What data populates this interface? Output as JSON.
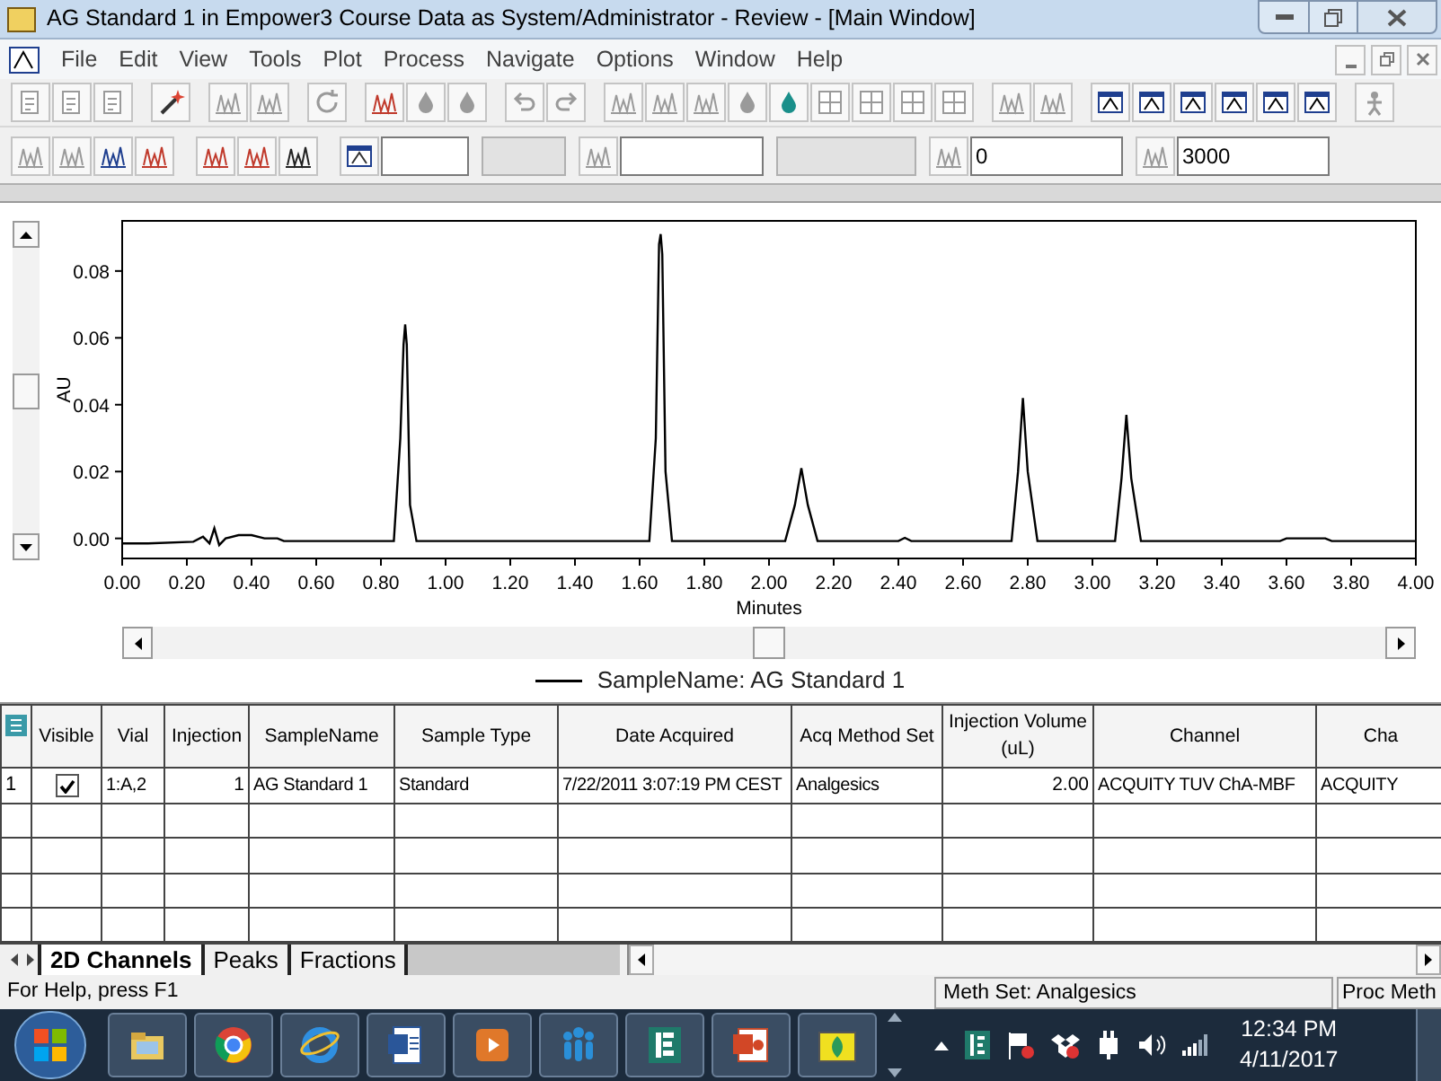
{
  "window": {
    "title": "AG Standard 1 in Empower3 Course Data as System/Administrator - Review - [Main Window]"
  },
  "menu": [
    "File",
    "Edit",
    "View",
    "Tools",
    "Plot",
    "Process",
    "Navigate",
    "Options",
    "Window",
    "Help"
  ],
  "toolbar_fields": [
    {
      "disabled": false
    },
    {
      "disabled": true
    },
    {
      "disabled": false
    },
    {
      "disabled": true
    },
    {
      "value": "0",
      "disabled": false
    },
    {
      "value": "3000",
      "disabled": false
    }
  ],
  "chromatogram": {
    "chart_data": {
      "type": "line",
      "xlabel": "Minutes",
      "ylabel": "AU",
      "xlim": [
        0,
        4
      ],
      "ylim": [
        -0.006,
        0.095
      ],
      "xticks": [
        {
          "value": 0,
          "label": "0.00"
        },
        {
          "value": 0.2,
          "label": "0.20"
        },
        {
          "value": 0.4,
          "label": "0.40"
        },
        {
          "value": 0.6,
          "label": "0.60"
        },
        {
          "value": 0.8,
          "label": "0.80"
        },
        {
          "value": 1,
          "label": "1.00"
        },
        {
          "value": 1.2,
          "label": "1.20"
        },
        {
          "value": 1.4,
          "label": "1.40"
        },
        {
          "value": 1.6,
          "label": "1.60"
        },
        {
          "value": 1.8,
          "label": "1.80"
        },
        {
          "value": 2,
          "label": "2.00"
        },
        {
          "value": 2.2,
          "label": "2.20"
        },
        {
          "value": 2.4,
          "label": "2.40"
        },
        {
          "value": 2.6,
          "label": "2.60"
        },
        {
          "value": 2.8,
          "label": "2.80"
        },
        {
          "value": 3,
          "label": "3.00"
        },
        {
          "value": 3.2,
          "label": "3.20"
        },
        {
          "value": 3.4,
          "label": "3.40"
        },
        {
          "value": 3.6,
          "label": "3.60"
        },
        {
          "value": 3.8,
          "label": "3.80"
        },
        {
          "value": 4,
          "label": "4.00"
        }
      ],
      "yticks": [
        {
          "value": 0,
          "label": "0.00"
        },
        {
          "value": 0.02,
          "label": "0.02"
        },
        {
          "value": 0.04,
          "label": "0.04"
        },
        {
          "value": 0.06,
          "label": "0.06"
        },
        {
          "value": 0.08,
          "label": "0.08"
        }
      ],
      "x": [
        0,
        0.08,
        0.22,
        0.25,
        0.27,
        0.285,
        0.3,
        0.32,
        0.36,
        0.4,
        0.44,
        0.48,
        0.5,
        0.84,
        0.86,
        0.87,
        0.875,
        0.88,
        0.89,
        0.91,
        1.63,
        1.65,
        1.66,
        1.665,
        1.67,
        1.68,
        1.7,
        2.05,
        2.08,
        2.1,
        2.12,
        2.15,
        2.4,
        2.42,
        2.44,
        2.75,
        2.77,
        2.785,
        2.8,
        2.83,
        3.07,
        3.09,
        3.105,
        3.12,
        3.15,
        3.58,
        3.6,
        3.72,
        3.74,
        4
      ],
      "series": [
        {
          "name": "SampleName: AG Standard 1",
          "color": "#000000",
          "values": [
            -0.0015,
            -0.0015,
            -0.001,
            0.0005,
            -0.0015,
            0.003,
            -0.002,
            0,
            0.001,
            0.001,
            0,
            0,
            -0.0008,
            -0.0008,
            0.03,
            0.058,
            0.064,
            0.058,
            0.01,
            -0.0008,
            -0.0008,
            0.03,
            0.088,
            0.091,
            0.085,
            0.02,
            -0.0008,
            -0.0008,
            0.01,
            0.021,
            0.01,
            -0.0008,
            -0.0008,
            0.0002,
            -0.0008,
            -0.0008,
            0.02,
            0.042,
            0.02,
            -0.0008,
            -0.0008,
            0.018,
            0.037,
            0.018,
            -0.0008,
            -0.0008,
            0,
            0,
            -0.0008,
            -0.0008
          ]
        }
      ]
    }
  },
  "table": {
    "columns": [
      "Visible",
      "Vial",
      "Injection",
      "SampleName",
      "Sample Type",
      "Date Acquired",
      "Acq Method Set",
      "Injection Volume (uL)",
      "Channel",
      "Cha"
    ],
    "rows": [
      {
        "number": "1",
        "cells": [
          {
            "kind": "checkbox",
            "checked": true
          },
          {
            "kind": "text",
            "text": "1:A,2"
          },
          {
            "kind": "number",
            "text": "1"
          },
          {
            "kind": "text",
            "text": "AG Standard 1"
          },
          {
            "kind": "text",
            "text": "Standard"
          },
          {
            "kind": "text",
            "text": "7/22/2011 3:07:19 PM CEST"
          },
          {
            "kind": "text",
            "text": "Analgesics"
          },
          {
            "kind": "number",
            "text": "2.00"
          },
          {
            "kind": "text",
            "text": "ACQUITY TUV ChA-MBF"
          },
          {
            "kind": "text",
            "text": "ACQUITY"
          }
        ]
      }
    ]
  },
  "tabs": [
    {
      "label": "2D Channels",
      "selected": true
    },
    {
      "label": "Peaks",
      "selected": false
    },
    {
      "label": "Fractions",
      "selected": false
    }
  ],
  "status_bar": [
    "For Help, press F1",
    "Meth Set: Analgesics",
    "Proc Meth"
  ],
  "taskbar": {
    "time": "12:34 PM",
    "date": "4/11/2017"
  }
}
